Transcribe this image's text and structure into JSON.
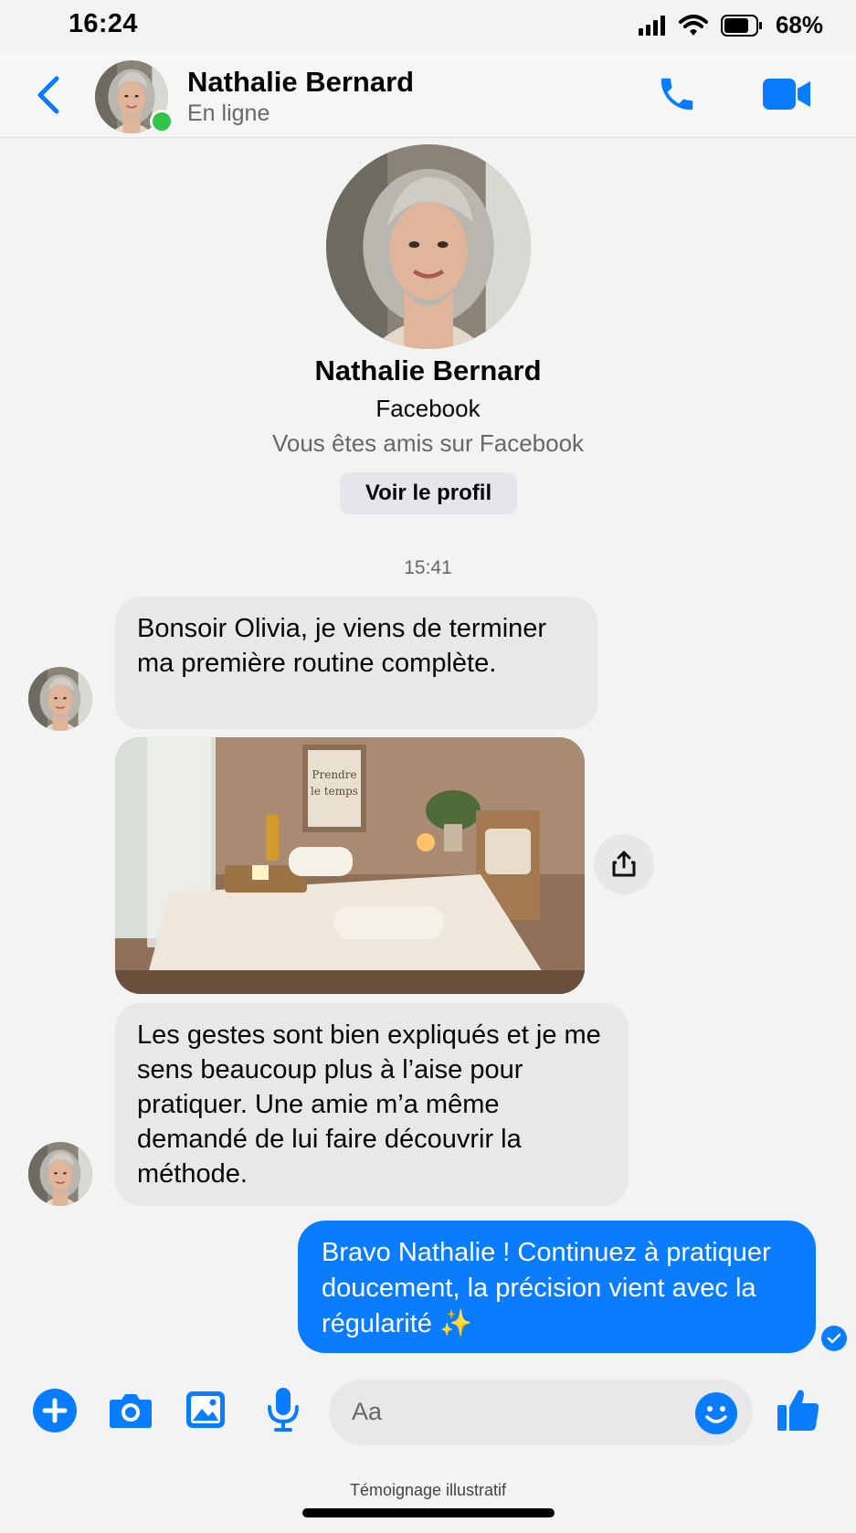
{
  "status_bar": {
    "time": "16:24",
    "battery": "68%"
  },
  "header": {
    "name": "Nathalie Bernard",
    "status": "En ligne"
  },
  "profile": {
    "name": "Nathalie Bernard",
    "source": "Facebook",
    "relation": "Vous êtes amis sur Facebook",
    "button": "Voir le profil"
  },
  "timestamp": "15:41",
  "messages": {
    "incoming_1": "Bonsoir Olivia, je viens de terminer ma première routine complète.",
    "incoming_2": "Les gestes sont bien expliqués et je me sens beaucoup plus à l’aise pour pratiquer. Une amie m’a même demandé de lui faire découvrir la méthode.",
    "outgoing_1": "Bravo Nathalie ! Continuez à pratiquer doucement, la précision vient avec la régularité ✨",
    "photo_sign": [
      "Prendre",
      "le temps"
    ]
  },
  "composer": {
    "placeholder": "Aa"
  },
  "footnote": "Témoignage illustratif",
  "colors": {
    "accent": "#0a7cff",
    "online": "#31c448",
    "bubble_in": "#e8e8ea"
  },
  "icons": [
    "back-chevron-icon",
    "phone-icon",
    "video-camera-icon",
    "share-icon",
    "plus-icon",
    "camera-icon",
    "image-icon",
    "microphone-icon",
    "emoji-icon",
    "thumbs-up-icon",
    "read-check-icon"
  ]
}
